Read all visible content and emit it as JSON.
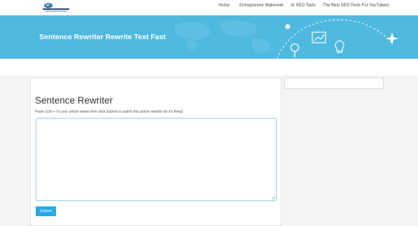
{
  "nav": {
    "logo_text": "FREE SEO TOOLS FOR",
    "items": [
      {
        "label": "Home"
      },
      {
        "label": "Entrepreneur Makeover"
      },
      {
        "label": "AI SEO Tools"
      },
      {
        "label": "The Best SEO Tools For YouTubers"
      }
    ]
  },
  "hero": {
    "title": "Sentence Rewriter Rewrite Text Fast"
  },
  "card": {
    "title": "Sentence Rewriter",
    "description": "Paste (Ctrl + V) your article below then click Submit to watch this article rewriter do it's thing!",
    "input_value": "",
    "submit_label": "Submit"
  },
  "colors": {
    "hero_bg": "#4fb8de",
    "accent": "#29abe2",
    "page_bg": "#f4f4f4"
  }
}
